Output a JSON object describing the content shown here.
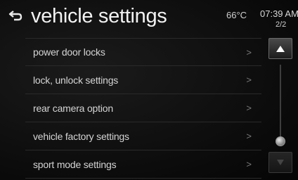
{
  "header": {
    "title": "vehicle settings",
    "temperature": "66°C",
    "time": "07:39 AM",
    "page_indicator": "2/2"
  },
  "icons": {
    "back": "back-arrow-icon",
    "chevron": "chevron-right-icon",
    "scroll_up": "arrow-up-icon",
    "scroll_down": "arrow-down-icon"
  },
  "list": {
    "items": [
      {
        "label": "power door locks",
        "chevron": ">"
      },
      {
        "label": "lock, unlock settings",
        "chevron": ">"
      },
      {
        "label": "rear camera option",
        "chevron": ">"
      },
      {
        "label": "vehicle factory settings",
        "chevron": ">"
      },
      {
        "label": "sport mode settings",
        "chevron": ">"
      }
    ]
  },
  "scroll": {
    "position": 1.0,
    "up_enabled": true,
    "down_enabled": false
  },
  "colors": {
    "background": "#0b0b0b",
    "text": "#d4d4d4",
    "divider": "#2a2a2a"
  }
}
